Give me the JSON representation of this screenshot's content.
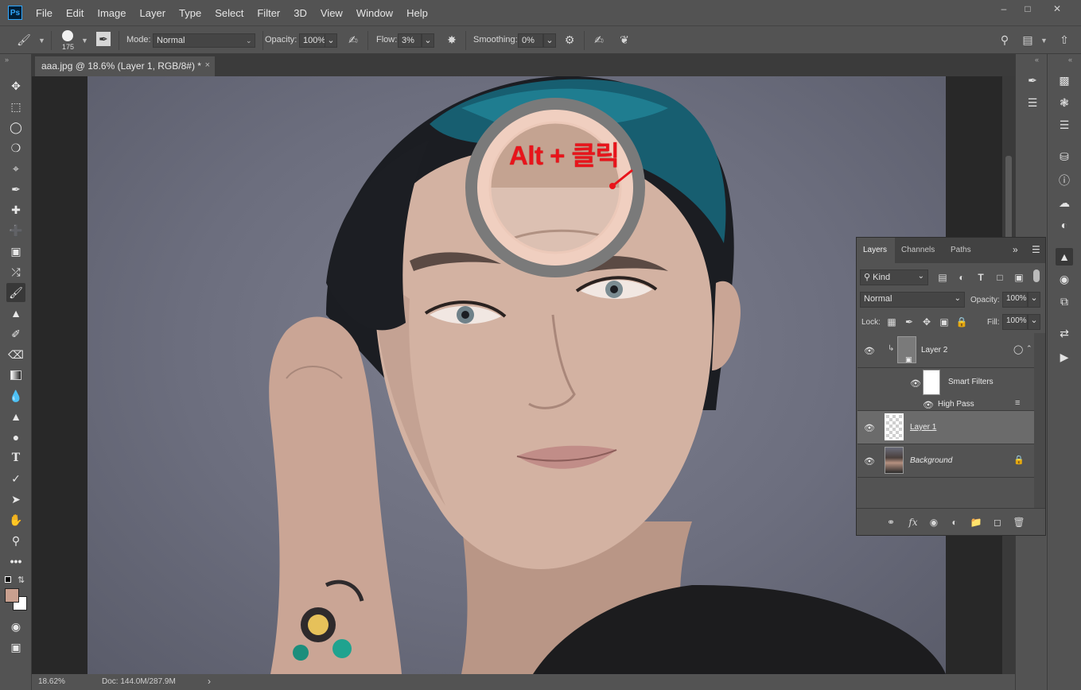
{
  "menubar": {
    "logo": "Ps",
    "items": [
      "File",
      "Edit",
      "Image",
      "Layer",
      "Type",
      "Select",
      "Filter",
      "3D",
      "View",
      "Window",
      "Help"
    ]
  },
  "options": {
    "brush_size": "175",
    "mode_label": "Mode:",
    "mode_value": "Normal",
    "opacity_label": "Opacity:",
    "opacity_value": "100%",
    "flow_label": "Flow:",
    "flow_value": "3%",
    "smoothing_label": "Smoothing:",
    "smoothing_value": "0%"
  },
  "document": {
    "tab_title": "aaa.jpg @ 18.6% (Layer 1, RGB/8#) *",
    "close": "×",
    "annotation": "Alt + 클릭"
  },
  "status": {
    "zoom": "18.62%",
    "doc": "Doc: 144.0M/287.9M",
    "arrow": "›"
  },
  "layers_panel": {
    "tabs": [
      "Layers",
      "Channels",
      "Paths"
    ],
    "expand": "»",
    "filter_kind": "Kind",
    "blend_mode": "Normal",
    "opacity_label": "Opacity:",
    "opacity_value": "100%",
    "lock_label": "Lock:",
    "fill_label": "Fill:",
    "fill_value": "100%",
    "layers": [
      {
        "name": "Layer 2"
      },
      {
        "name": "Smart Filters"
      },
      {
        "name": "High Pass"
      },
      {
        "name": "Layer 1"
      },
      {
        "name": "Background"
      }
    ]
  },
  "colors": {
    "foreground": "#c9a08f",
    "background": "#ffffff",
    "accent_red": "#e8141b"
  }
}
